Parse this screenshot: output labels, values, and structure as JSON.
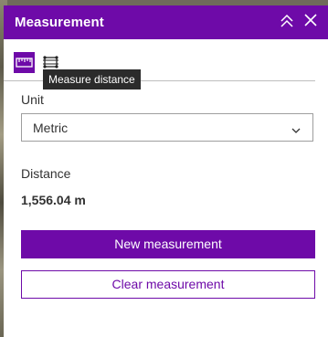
{
  "header": {
    "title": "Measurement",
    "collapse_icon": "chevrons-up-icon",
    "close_icon": "close-icon"
  },
  "toolbar": {
    "distance_tool_icon": "measure-distance-icon",
    "area_tool_icon": "measure-area-icon",
    "tooltip": "Measure distance"
  },
  "unit": {
    "label": "Unit",
    "selected": "Metric"
  },
  "distance": {
    "label": "Distance",
    "value": "1,556.04 m"
  },
  "buttons": {
    "new": "New measurement",
    "clear": "Clear measurement"
  },
  "colors": {
    "accent": "#6e0aa8",
    "text": "#323232"
  }
}
